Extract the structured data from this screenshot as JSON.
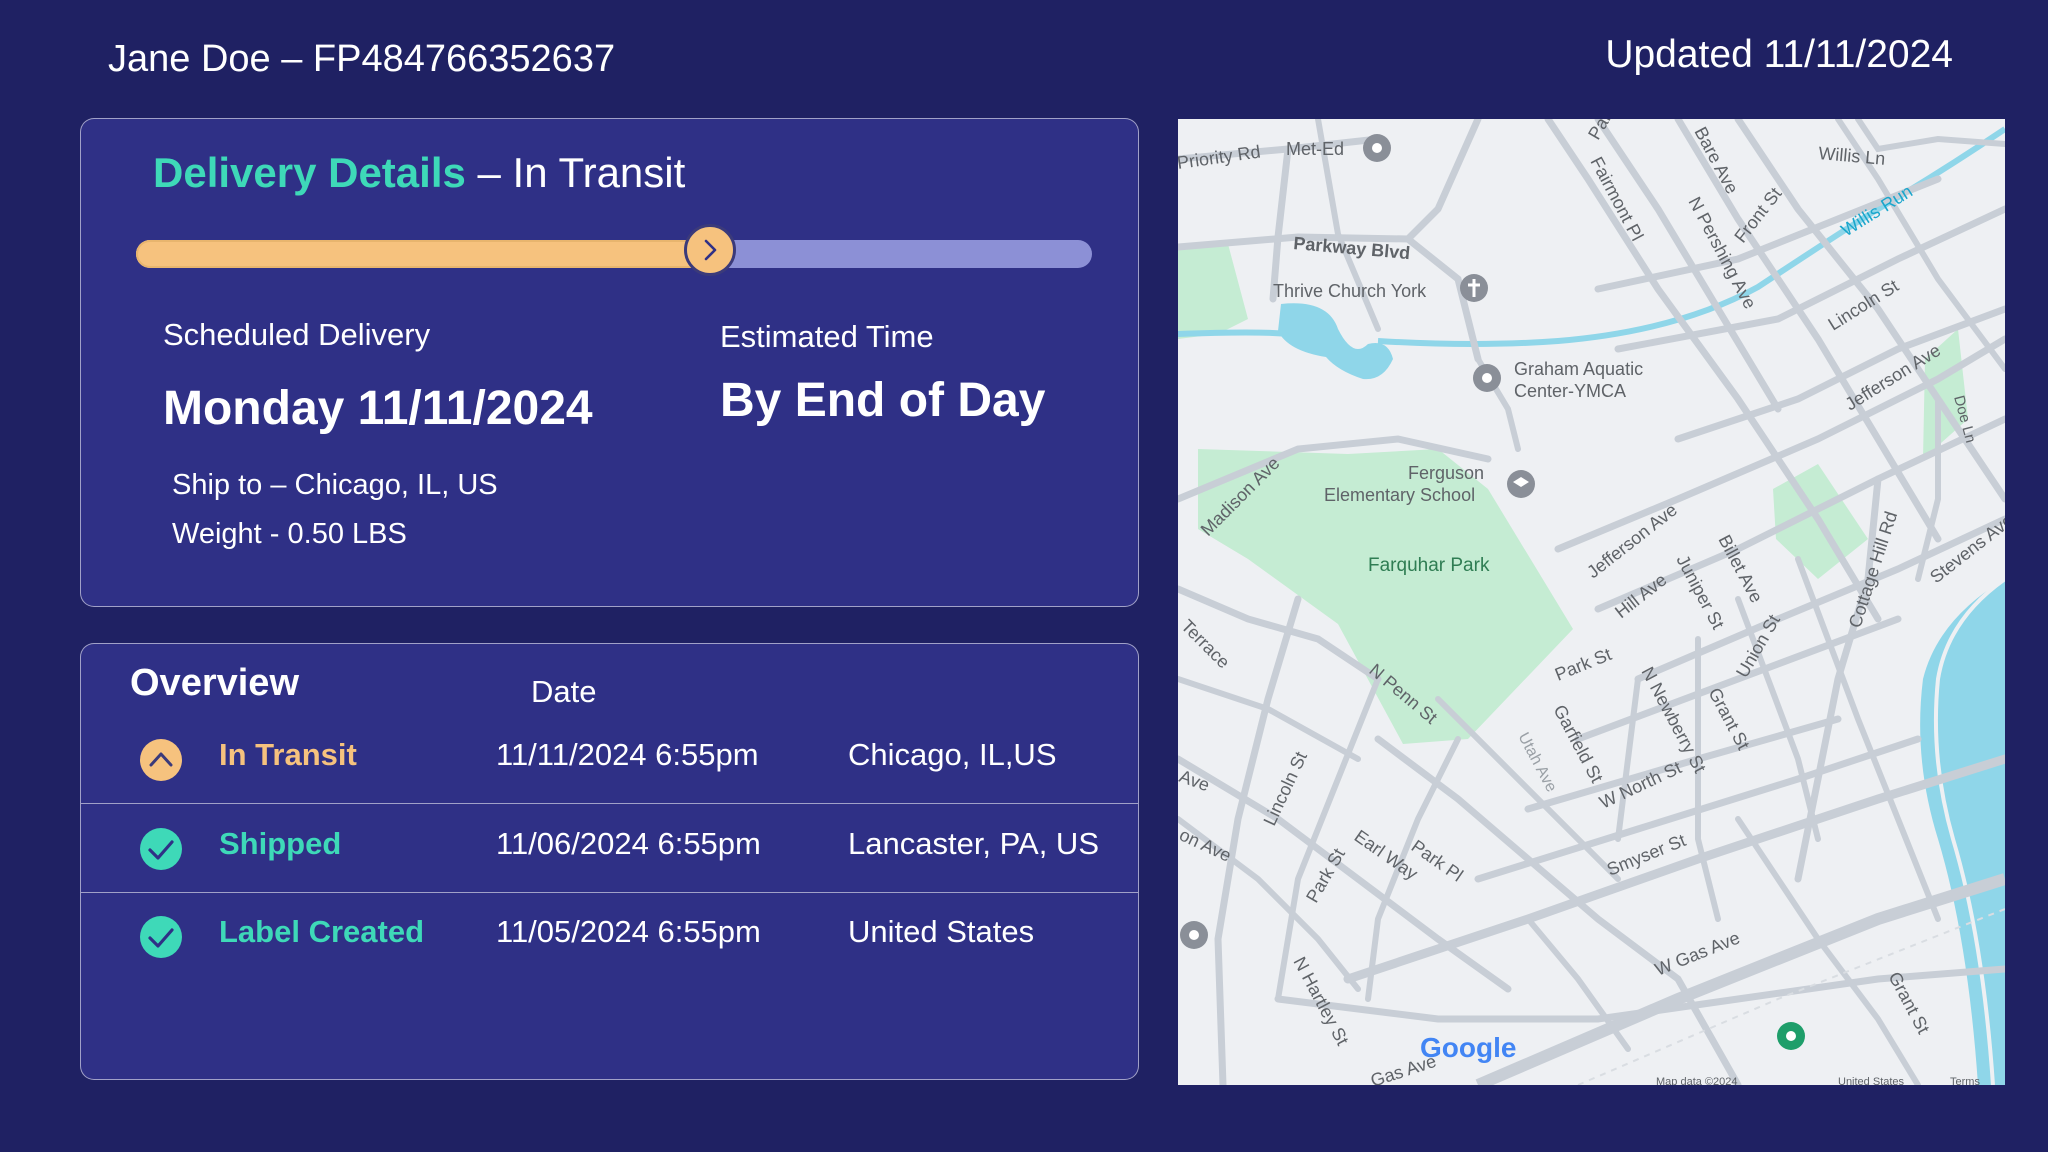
{
  "header": {
    "customer_tracking": "Jane Doe – FP484766352637",
    "updated": "Updated 11/11/2024"
  },
  "details": {
    "title_accent": "Delivery Details",
    "title_rest": " – In Transit",
    "progress_fraction": 0.6,
    "scheduled_label": "Scheduled Delivery",
    "scheduled_value": "Monday 11/11/2024",
    "estimated_label": "Estimated Time",
    "estimated_value": "By End of Day",
    "ship_to": "Ship to – Chicago, IL, US",
    "weight": "Weight - 0.50 LBS"
  },
  "overview": {
    "title": "Overview",
    "date_header": "Date",
    "rows": [
      {
        "status": "In Transit",
        "date": "11/11/2024 6:55pm",
        "location": "Chicago, IL,US",
        "icon": "chevron-up-circle-icon",
        "color": "#f6c27e"
      },
      {
        "status": "Shipped",
        "date": "11/06/2024 6:55pm",
        "location": "Lancaster, PA, US",
        "icon": "check-circle-icon",
        "color": "#3ed9b8"
      },
      {
        "status": "Label Created",
        "date": "11/05/2024 6:55pm",
        "location": "United States",
        "icon": "check-circle-icon",
        "color": "#3ed9b8"
      }
    ]
  },
  "map": {
    "labels": {
      "priority_rd": "Priority Rd",
      "met_ed": "Met-Ed",
      "park": "Park",
      "bare_ave": "Bare Ave",
      "willis_ln": "Willis Ln",
      "fairmont_pl": "Fairmont Pl",
      "n_pershing_ave": "N Pershing Ave",
      "front_st": "Front St",
      "willis_run": "Willis Run",
      "parkway_blvd": "Parkway Blvd",
      "thrive_church": "Thrive Church York",
      "lincoln_st_top": "Lincoln St",
      "graham_1": "Graham Aquatic",
      "graham_2": "Center-YMCA",
      "jefferson_ave_top": "Jefferson Ave",
      "doe_ln": "Doe Ln",
      "madison_ave": "Madison Ave",
      "ferguson_1": "Ferguson",
      "ferguson_2": "Elementary School",
      "farquhar_park": "Farquhar Park",
      "jefferson_ave_mid": "Jefferson Ave",
      "juniper_st": "Juniper St",
      "billet_ave": "Billet Ave",
      "hill_ave": "Hill Ave",
      "cottage_hill_rd": "Cottage Hill Rd",
      "stevens_ave": "Stevens Ave",
      "terrace": "Terrace",
      "park_st": "Park St",
      "union_st": "Union St",
      "n_penn_st": "N Penn St",
      "n_newberry_st": "N Newberry St",
      "grant_st_mid": "Grant St",
      "garfield_st": "Garfield St",
      "utah_ave": "Utah Ave",
      "w_north_st": "W North St",
      "lincoln_st_bottom": "Lincoln St",
      "earl_way": "Earl Way",
      "park_pl": "Park Pl",
      "park_st_bottom": "Park St",
      "smyser_st": "Smyser St",
      "ave_left": "Ave",
      "on_ave": "on Ave",
      "n_hartley_st": "N Hartley St",
      "w_gas_ave": "W Gas Ave",
      "grant_st_bottom": "Grant St",
      "gas_ave_bottom": "Gas Ave",
      "google": "Google",
      "map_data": "Map data ©2024",
      "united_states": "United States",
      "terms": "Terms"
    }
  }
}
